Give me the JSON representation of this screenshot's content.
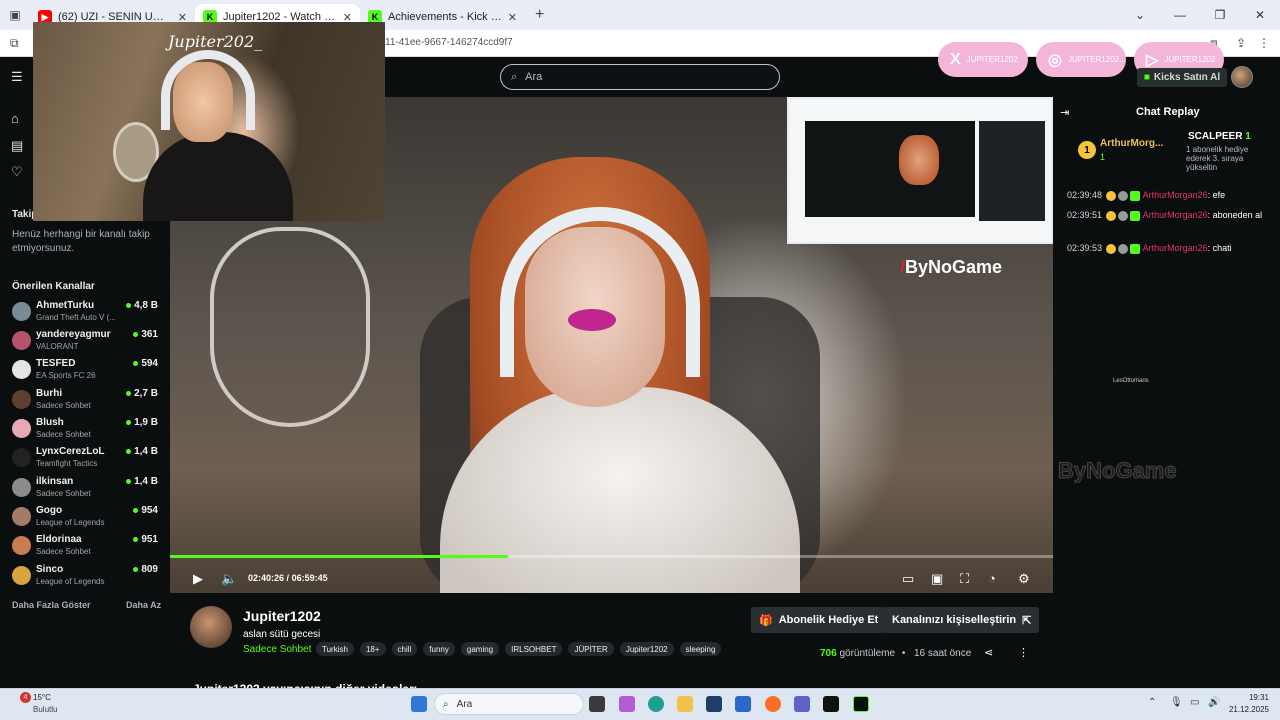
{
  "browser": {
    "tabs": [
      {
        "label": "(62) UZI - SENIN UGRUNA FT M",
        "fav_color": "#ff0000",
        "fav": "▶"
      },
      {
        "label": "Jupiter1202 - Watch the VOD o",
        "fav_color": "#53fc18",
        "fav": "K"
      },
      {
        "label": "Achievements - Kick Dashboard",
        "fav_color": "#53fc18",
        "fav": "K"
      }
    ],
    "url_fragment": "11-41ee-9667-146274ccd9f7",
    "new_tab": "+",
    "close": "✕"
  },
  "header": {
    "search_placeholder": "Ara",
    "socials": [
      {
        "icon": "X",
        "label": "JUPITER1202"
      },
      {
        "icon": "◎",
        "label": "JUPITER1202..."
      },
      {
        "icon": "▷",
        "label": "JUPITER1202"
      }
    ],
    "kicks_label": "Kicks Satın Al"
  },
  "sidebar": {
    "following_heading": "Takip",
    "following_empty": "Henüz herhangi bir kanalı takip etmiyorsunuz.",
    "recommended_heading": "Önerilen Kanallar",
    "channels": [
      {
        "name": "AhmetTurku",
        "category": "Grand Theft Auto V (...",
        "viewers": "4,8 B",
        "color": "#7a8b95"
      },
      {
        "name": "yandereyagmur",
        "category": "VALORANT",
        "viewers": "361",
        "color": "#b4536a"
      },
      {
        "name": "TESFED",
        "category": "EA Sports FC 26",
        "viewers": "594",
        "color": "#e5e5e5"
      },
      {
        "name": "Burhi",
        "category": "Sadece Sohbet",
        "viewers": "2,7 B",
        "color": "#5e4030"
      },
      {
        "name": "Blush",
        "category": "Sadece Sohbet",
        "viewers": "1,9 B",
        "color": "#e7a8b8"
      },
      {
        "name": "LynxCerezLoL",
        "category": "Teamfight Tactics",
        "viewers": "1,4 B",
        "color": "#222222"
      },
      {
        "name": "ilkinsan",
        "category": "Sadece Sohbet",
        "viewers": "1,4 B",
        "color": "#8b8b8b"
      },
      {
        "name": "Gogo",
        "category": "League of Legends",
        "viewers": "954",
        "color": "#a37b6a"
      },
      {
        "name": "Eldorinaa",
        "category": "Sadece Sohbet",
        "viewers": "951",
        "color": "#c97b52"
      },
      {
        "name": "Sinco",
        "category": "League of Legends",
        "viewers": "809",
        "color": "#d9a43e"
      }
    ],
    "show_more": "Daha Fazla Göster",
    "show_less": "Daha Az"
  },
  "webcam": {
    "overlay_name": "Jupiter202_"
  },
  "video": {
    "sponsor_prefix": "/",
    "sponsor": "ByNoGame",
    "time_current": "02:40:26",
    "time_separator": "/",
    "time_total": "06:59:45",
    "progress": 0.3825
  },
  "chat": {
    "title": "Chat Replay",
    "pinned": {
      "rank": "1",
      "user": "ArthurMorg...",
      "sub_count": "1",
      "gifter": "SCALPEER",
      "gifter_count": "1",
      "gift_text": "1 abonelik hediye ederek 3. sıraya yükseltin"
    },
    "messages": [
      {
        "time": "02:39:48",
        "user": "ArthurMorgan26",
        "text": ": efe"
      },
      {
        "time": "02:39:51",
        "user": "ArthurMorgan26",
        "text": ": aboneden al"
      },
      {
        "time": "02:39:53",
        "user": "ArthurMorgan26",
        "text": ": chati"
      }
    ],
    "sponsor_logo": "ByNoGame",
    "small_label": "LesOttomans"
  },
  "channel": {
    "name": "Jupiter1202",
    "stream_title": "aslan sütü gecesi",
    "category": "Sadece Sohbet",
    "tags": [
      "Turkish",
      "18+",
      "chill",
      "funny",
      "gaming",
      "IRLSOHBET",
      "JÜPİTER",
      "Jupiter1202",
      "sleeping"
    ],
    "gift_sub_button": "Abonelik Hediye Et",
    "customize_button": "Kanalınızı kişiselleştirin",
    "views_number": "706",
    "views_label": "görüntüleme",
    "bullet": "•",
    "ago": "16 saat önce",
    "other_videos": "Jupiter1202 yayıncısının diğer videoları"
  },
  "taskbar": {
    "weather_badge": "4",
    "temperature": "15°C",
    "weather_desc": "Bulutlu",
    "search_placeholder": "Ara",
    "time": "19:31",
    "date": "21.12.2025"
  }
}
